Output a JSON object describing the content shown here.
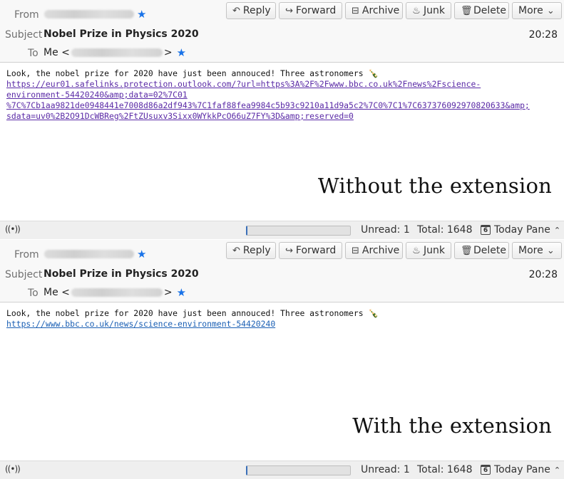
{
  "panels": [
    {
      "labels": {
        "from": "From",
        "subject": "Subject",
        "to": "To"
      },
      "to_prefix": "Me <",
      "to_suffix": ">",
      "subject": "Nobel Prize in Physics 2020",
      "time": "20:28",
      "toolbar": {
        "reply": "Reply",
        "forward": "Forward",
        "archive": "Archive",
        "junk": "Junk",
        "delete": "Delete",
        "more": "More"
      },
      "body_text": "Look, the nobel prize for 2020 have just been annouced! Three astronomers 🍾",
      "link_lines": [
        "https://eur01.safelinks.protection.outlook.com/?url=https%3A%2F%2Fwww.bbc.co.uk%2Fnews%2Fscience-",
        "environment-54420240&amp;data=02%7C01",
        "%7C%7Cb1aa9821de0948441e7008d86a2df943%7C1faf88fea9984c5b93c9210a11d9a5c2%7C0%7C1%7C637376092970820633&amp;",
        "sdata=uv0%2B2O91DcWBReg%2FtZUsuxv3Sixx0WYkkPcO66uZ7FY%3D&amp;reserved=0"
      ],
      "overlay_caption": "Without the extension",
      "status": {
        "unread": "Unread: 1",
        "total": "Total: 1648",
        "today_pane": "Today Pane",
        "calendar_day": "6",
        "progress": 0.0
      }
    },
    {
      "labels": {
        "from": "From",
        "subject": "Subject",
        "to": "To"
      },
      "to_prefix": "Me <",
      "to_suffix": ">",
      "subject": "Nobel Prize in Physics 2020",
      "time": "20:28",
      "toolbar": {
        "reply": "Reply",
        "forward": "Forward",
        "archive": "Archive",
        "junk": "Junk",
        "delete": "Delete",
        "more": "More"
      },
      "body_text": "Look, the nobel prize for 2020 have just been annouced! Three astronomers 🍾",
      "link_lines": [
        "https://www.bbc.co.uk/news/science-environment-54420240"
      ],
      "overlay_caption": "With the extension",
      "status": {
        "unread": "Unread: 1",
        "total": "Total: 1648",
        "today_pane": "Today Pane",
        "calendar_day": "6",
        "progress": 0.0
      }
    }
  ],
  "icons": {
    "reply": "reply-icon",
    "forward": "forward-icon",
    "archive": "archive-icon",
    "junk": "junk-icon",
    "delete": "trash-icon",
    "more": "chevron-down-icon",
    "star": "star-icon",
    "signal": "online-status-icon",
    "calendar": "calendar-icon"
  },
  "colors": {
    "star": "#1a73e8",
    "link_visited": "#5a2aa6",
    "link": "#1a5fb4",
    "progress": "#3a6fb8"
  }
}
